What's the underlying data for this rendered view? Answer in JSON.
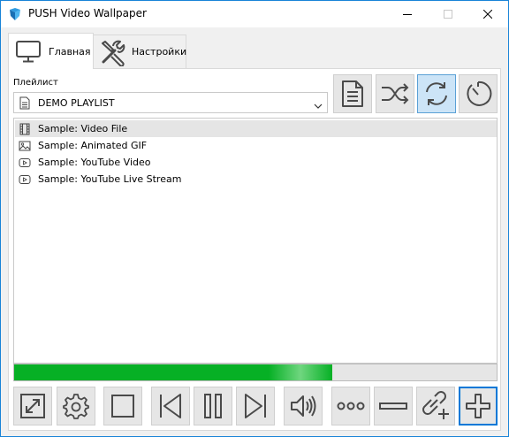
{
  "window": {
    "title": "PUSH Video Wallpaper",
    "app_icon": "push-logo-icon",
    "accent_color": "#1883d7"
  },
  "tabs": [
    {
      "label": "Главная",
      "icon": "monitor-icon",
      "selected": true
    },
    {
      "label": "Настройки",
      "icon": "wrench-screwdriver-icon",
      "selected": false
    }
  ],
  "playlist": {
    "label": "Плейлист",
    "selected_value": "DEMO PLAYLIST",
    "icon": "document-icon"
  },
  "toolbar": [
    {
      "name": "playlist-editor-button",
      "icon": "document-lines-icon",
      "active": false
    },
    {
      "name": "shuffle-button",
      "icon": "shuffle-icon",
      "active": false
    },
    {
      "name": "repeat-button",
      "icon": "repeat-icon",
      "active": true
    },
    {
      "name": "timer-button",
      "icon": "stopwatch-icon",
      "active": false
    }
  ],
  "items": [
    {
      "label": "Sample: Video File",
      "icon": "film-icon",
      "selected": true
    },
    {
      "label": "Sample: Animated GIF",
      "icon": "image-icon",
      "selected": false
    },
    {
      "label": "Sample: YouTube Video",
      "icon": "youtube-play-icon",
      "selected": false
    },
    {
      "label": "Sample: YouTube Live Stream",
      "icon": "youtube-play-icon",
      "selected": false
    }
  ],
  "progress": {
    "value_percent": 66,
    "color": "#06b025"
  },
  "controls": [
    {
      "name": "fullscreen-button",
      "icon": "expand-icon"
    },
    {
      "name": "settings-button",
      "icon": "gear-icon"
    },
    {
      "name": "stop-button",
      "icon": "stop-icon"
    },
    {
      "name": "previous-button",
      "icon": "skip-previous-icon"
    },
    {
      "name": "pause-button",
      "icon": "pause-icon"
    },
    {
      "name": "next-button",
      "icon": "skip-next-icon"
    },
    {
      "name": "volume-button",
      "icon": "speaker-icon"
    },
    {
      "name": "more-button",
      "icon": "ellipsis-icon"
    },
    {
      "name": "remove-button",
      "icon": "minus-icon"
    },
    {
      "name": "add-url-button",
      "icon": "link-add-icon"
    },
    {
      "name": "add-file-button",
      "icon": "plus-icon",
      "focused": true
    }
  ]
}
